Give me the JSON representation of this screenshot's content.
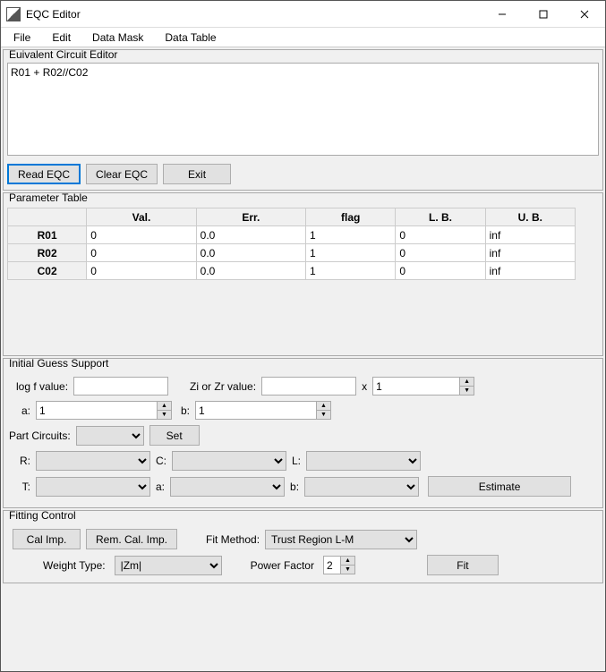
{
  "titlebar": {
    "title": "EQC Editor"
  },
  "menubar": {
    "items": [
      "File",
      "Edit",
      "Data Mask",
      "Data Table"
    ]
  },
  "eqc": {
    "section_title": "Euivalent Circuit Editor",
    "text": "R01 + R02//C02",
    "read_btn": "Read EQC",
    "clear_btn": "Clear EQC",
    "exit_btn": "Exit"
  },
  "param": {
    "section_title": "Parameter Table",
    "headers": [
      "Val.",
      "Err.",
      "flag",
      "L. B.",
      "U. B."
    ],
    "rows": [
      {
        "name": "R01",
        "val": "0",
        "err": "0.0",
        "flag": "1",
        "lb": "0",
        "ub": "inf"
      },
      {
        "name": "R02",
        "val": "0",
        "err": "0.0",
        "flag": "1",
        "lb": "0",
        "ub": "inf"
      },
      {
        "name": "C02",
        "val": "0",
        "err": "0.0",
        "flag": "1",
        "lb": "0",
        "ub": "inf"
      }
    ]
  },
  "guess": {
    "section_title": "Initial Guess Support",
    "logf_label": "log f value:",
    "logf_value": "",
    "zi_label": "Zi or Zr value:",
    "zi_value": "",
    "x_label": "x",
    "x_value": "1",
    "a_label": "a:",
    "a_value": "1",
    "b_label": "b:",
    "b_value": "1",
    "part_label": "Part Circuits:",
    "part_value": "",
    "set_btn": "Set",
    "r_label": "R:",
    "c_label": "C:",
    "l_label": "L:",
    "t_label": "T:",
    "a2_label": "a:",
    "b2_label": "b:",
    "estimate_btn": "Estimate"
  },
  "fit": {
    "section_title": "Fitting Control",
    "cal_btn": "Cal Imp.",
    "rem_btn": "Rem. Cal. Imp.",
    "method_label": "Fit Method:",
    "method_value": "Trust Region L-M",
    "weight_label": "Weight Type:",
    "weight_value": "|Zm|",
    "power_label": "Power Factor",
    "power_value": "2",
    "fit_btn": "Fit"
  }
}
